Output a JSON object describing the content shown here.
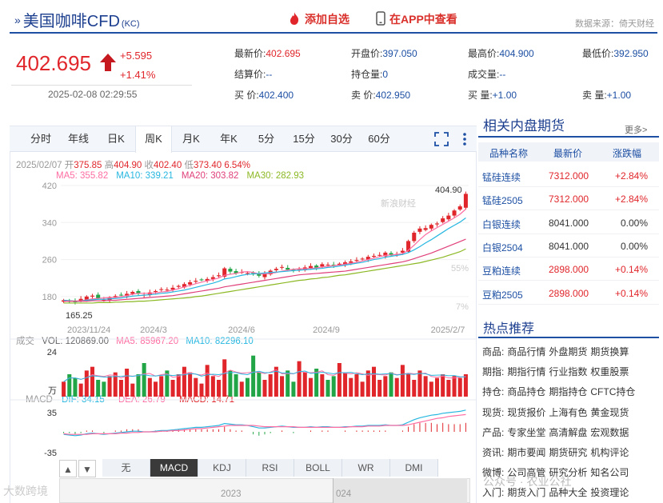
{
  "header": {
    "title": "美国咖啡CFD",
    "code": "(KC)",
    "add_label": "添加自选",
    "app_label": "在APP中查看",
    "source": "数据来源：倚天财经"
  },
  "quote": {
    "price": "402.695",
    "change": "+5.595",
    "change_pct": "+1.41%",
    "time": "2025-02-08 02:29:55",
    "fields": [
      {
        "label": "最新价:",
        "value": "402.695",
        "red": true
      },
      {
        "label": "开盘价:",
        "value": "397.050"
      },
      {
        "label": "最高价:",
        "value": "404.900"
      },
      {
        "label": "最低价:",
        "value": "392.950"
      },
      {
        "label": "结算价:",
        "value": "--"
      },
      {
        "label": "持仓量:",
        "value": "0"
      },
      {
        "label": "成交量:",
        "value": "--"
      },
      {
        "label": "",
        "value": ""
      },
      {
        "label": "买  价:",
        "value": "402.400"
      },
      {
        "label": "卖  价:",
        "value": "402.950"
      },
      {
        "label": "买  量:",
        "value": "+1.00"
      },
      {
        "label": "卖  量:",
        "value": "+1.00"
      }
    ]
  },
  "tabs": [
    "分时",
    "年线",
    "日K",
    "周K",
    "月K",
    "年K",
    "5分",
    "15分",
    "30分",
    "60分"
  ],
  "active_tab": "周K",
  "ohlc": {
    "date": "2025/02/07",
    "open_label": "开",
    "open": "375.85",
    "high_label": "高",
    "high": "404.90",
    "close_label": "收",
    "close": "402.40",
    "low_label": "低",
    "low": "373.40",
    "pct": "6.54%"
  },
  "ma": [
    {
      "label": "MA5: 355.82",
      "color": "#ff6da2"
    },
    {
      "label": "MA10: 339.21",
      "color": "#27b7e0"
    },
    {
      "label": "MA20: 303.82",
      "color": "#e0407a"
    },
    {
      "label": "MA30: 282.93",
      "color": "#8cb824"
    }
  ],
  "volume": {
    "title": "成交",
    "vol": "VOL: 120869.00",
    "ma5": "MA5: 85967.20",
    "ma10": "MA10: 82296.10",
    "axis_top": "24",
    "axis_unit": "万"
  },
  "macd": {
    "title": "MACD",
    "dif": "DIF: 34.15",
    "dea": "DEA: 26.79",
    "macd": "MACD: 14.71",
    "axis_top": "35",
    "axis_bottom": "-35"
  },
  "indicator_tabs": [
    "无",
    "MACD",
    "KDJ",
    "RSI",
    "BOLL",
    "WR",
    "DMI"
  ],
  "active_indicator": "MACD",
  "nav_years": [
    "2023",
    "024"
  ],
  "chart_data": {
    "type": "candlestick",
    "title": "美国咖啡CFD 周K",
    "ylim": [
      140,
      420
    ],
    "y_ticks": [
      "420",
      "340",
      "260",
      "180"
    ],
    "x_ticks": [
      "2023/11/24",
      "2024/3",
      "2024/6",
      "2024/9",
      "2025/2/7"
    ],
    "max_label": "404.90",
    "min_label": "165.25",
    "pct_labels": [
      "55%",
      "7%"
    ],
    "series": [
      {
        "name": "close",
        "values": [
          172,
          170,
          168,
          175,
          180,
          182,
          176,
          173,
          178,
          181,
          183,
          186,
          190,
          186,
          184,
          189,
          192,
          196,
          195,
          199,
          203,
          207,
          211,
          214,
          216,
          218,
          222,
          226,
          241,
          234,
          230,
          233,
          231,
          228,
          225,
          229,
          236,
          240,
          244,
          238,
          236,
          240,
          243,
          246,
          242,
          250,
          249,
          247,
          251,
          254,
          256,
          259,
          262,
          266,
          268,
          270,
          275,
          269,
          272,
          279,
          300,
          318,
          327,
          328,
          335,
          338,
          349,
          355,
          366,
          375,
          402
        ]
      },
      {
        "name": "MA5",
        "values": [
          172,
          171,
          170,
          171,
          173,
          175,
          176,
          177,
          178,
          178,
          180,
          182,
          185,
          187,
          187,
          187,
          188,
          190,
          191,
          194,
          197,
          201,
          204,
          208,
          211,
          214,
          217,
          220,
          226,
          228,
          230,
          233,
          234,
          232,
          229,
          229,
          230,
          232,
          235,
          237,
          239,
          240,
          240,
          241,
          242,
          244,
          245,
          247,
          248,
          250,
          252,
          254,
          257,
          260,
          263,
          266,
          269,
          270,
          271,
          273,
          280,
          291,
          303,
          314,
          322,
          329,
          336,
          343,
          350,
          358,
          369
        ]
      },
      {
        "name": "MA10",
        "values": [
          172,
          171,
          170,
          170,
          172,
          173,
          174,
          174,
          175,
          176,
          177,
          179,
          181,
          182,
          183,
          184,
          185,
          187,
          188,
          190,
          192,
          194,
          197,
          200,
          203,
          206,
          209,
          213,
          218,
          220,
          223,
          226,
          228,
          229,
          230,
          231,
          232,
          233,
          234,
          235,
          236,
          237,
          238,
          239,
          240,
          241,
          243,
          244,
          246,
          248,
          250,
          252,
          254,
          257,
          260,
          262,
          265,
          267,
          269,
          271,
          275,
          281,
          288,
          296,
          303,
          311,
          319,
          327,
          334,
          341,
          350
        ]
      },
      {
        "name": "MA20",
        "values": [
          170,
          170,
          170,
          170,
          170,
          171,
          171,
          171,
          172,
          172,
          173,
          174,
          175,
          176,
          177,
          178,
          179,
          180,
          181,
          182,
          184,
          186,
          188,
          190,
          192,
          194,
          196,
          198,
          201,
          203,
          205,
          207,
          209,
          211,
          213,
          215,
          217,
          219,
          221,
          223,
          225,
          227,
          228,
          229,
          230,
          231,
          232,
          233,
          234,
          235,
          237,
          239,
          241,
          243,
          245,
          247,
          249,
          251,
          253,
          255,
          258,
          262,
          266,
          270,
          274,
          279,
          284,
          289,
          294,
          299,
          304
        ]
      },
      {
        "name": "MA30",
        "values": [
          166,
          166,
          166,
          166,
          166,
          166,
          167,
          167,
          167,
          168,
          168,
          169,
          169,
          170,
          170,
          171,
          172,
          173,
          174,
          175,
          176,
          177,
          178,
          180,
          181,
          183,
          185,
          187,
          189,
          191,
          193,
          195,
          197,
          199,
          201,
          203,
          205,
          207,
          209,
          211,
          213,
          215,
          216,
          218,
          219,
          221,
          222,
          224,
          226,
          227,
          229,
          231,
          233,
          235,
          237,
          239,
          241,
          243,
          245,
          247,
          249,
          251,
          253,
          256,
          259,
          262,
          265,
          269,
          273,
          277,
          283
        ]
      }
    ],
    "volume_values": [
      8,
      12,
      10,
      7,
      14,
      16,
      9,
      8,
      11,
      13,
      9,
      15,
      7,
      12,
      18,
      10,
      8,
      11,
      14,
      9,
      12,
      16,
      13,
      10,
      7,
      17,
      11,
      9,
      20,
      14,
      12,
      8,
      10,
      22,
      13,
      9,
      12,
      16,
      11,
      14,
      8,
      19,
      13,
      10,
      15,
      12,
      9,
      11,
      18,
      13,
      10,
      12,
      8,
      14,
      16,
      9,
      11,
      13,
      10,
      17,
      12,
      9,
      14,
      11,
      8,
      10,
      12,
      9,
      11,
      10,
      12
    ],
    "macd_dif": [
      -4,
      -5,
      -6,
      -5,
      -3,
      -2,
      -3,
      -4,
      -3,
      -2,
      -1,
      0,
      1,
      1,
      0,
      0,
      1,
      2,
      2,
      3,
      4,
      5,
      6,
      7,
      7,
      8,
      9,
      10,
      13,
      12,
      11,
      11,
      10,
      8,
      6,
      6,
      7,
      8,
      9,
      8,
      7,
      7,
      7,
      8,
      7,
      8,
      8,
      7,
      7,
      8,
      8,
      9,
      9,
      10,
      10,
      10,
      11,
      10,
      10,
      11,
      15,
      19,
      22,
      24,
      26,
      27,
      29,
      30,
      31,
      32,
      34
    ],
    "macd_dea": [
      -3,
      -4,
      -4,
      -4,
      -4,
      -3,
      -3,
      -3,
      -3,
      -3,
      -2,
      -2,
      -1,
      -1,
      0,
      0,
      0,
      1,
      1,
      2,
      2,
      3,
      4,
      5,
      5,
      6,
      7,
      8,
      9,
      10,
      10,
      10,
      10,
      10,
      9,
      8,
      8,
      8,
      8,
      8,
      8,
      7,
      7,
      7,
      7,
      7,
      7,
      7,
      7,
      7,
      8,
      8,
      8,
      9,
      9,
      9,
      10,
      10,
      10,
      10,
      11,
      13,
      15,
      17,
      19,
      21,
      22,
      24,
      25,
      26,
      27
    ]
  },
  "right_panel": {
    "title": "相关内盘期货",
    "more": "更多>",
    "headers": [
      "品种名称",
      "最新价",
      "涨跌幅"
    ],
    "rows": [
      {
        "name": "锰硅连续",
        "price": "7312.000",
        "pct": "+2.84%",
        "up": true
      },
      {
        "name": "锰硅2505",
        "price": "7312.000",
        "pct": "+2.84%",
        "up": true
      },
      {
        "name": "白银连续",
        "price": "8041.000",
        "pct": "0.00%",
        "up": false
      },
      {
        "name": "白银2504",
        "price": "8041.000",
        "pct": "0.00%",
        "up": false
      },
      {
        "name": "豆粕连续",
        "price": "2898.000",
        "pct": "+0.14%",
        "up": true
      },
      {
        "name": "豆粕2505",
        "price": "2898.000",
        "pct": "+0.14%",
        "up": true
      }
    ]
  },
  "hot": {
    "title": "热点推荐",
    "rows": [
      {
        "cat": "商品:",
        "links": [
          "商品行情",
          "外盘期货",
          "期货换算"
        ]
      },
      {
        "cat": "期指:",
        "links": [
          "期指行情",
          "行业指数",
          "权重股票"
        ]
      },
      {
        "cat": "持仓:",
        "links": [
          "商品持仓",
          "期指持仓",
          "CFTC持仓"
        ]
      },
      {
        "cat": "现货:",
        "links": [
          "现货报价",
          "上海有色",
          "黄金现货"
        ]
      },
      {
        "cat": "产品:",
        "links": [
          "专家坐堂",
          "高清解盘",
          "宏观数据"
        ]
      },
      {
        "cat": "资讯:",
        "links": [
          "期市要闻",
          "期货研究",
          "机构评论"
        ]
      },
      {
        "cat": "微博:",
        "links": [
          "公司高管",
          "研究分析",
          "知名公司"
        ]
      },
      {
        "cat": "入门:",
        "links": [
          "期货入门",
          "品种大全",
          "投资理论"
        ]
      }
    ]
  },
  "watermarks": [
    "新浪财经",
    "大数跨境",
    "公众号 · 农业公社"
  ]
}
